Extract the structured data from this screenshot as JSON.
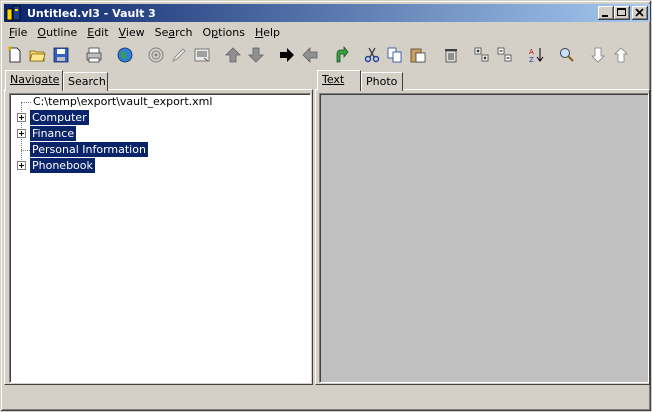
{
  "window": {
    "title": "Untitled.vl3 - Vault 3",
    "min_label": "minimize",
    "max_label": "maximize",
    "close_label": "close"
  },
  "menu": {
    "items": [
      {
        "label": "File"
      },
      {
        "label": "Outline"
      },
      {
        "label": "Edit"
      },
      {
        "label": "View"
      },
      {
        "label": "Search"
      },
      {
        "label": "Options"
      },
      {
        "label": "Help"
      }
    ]
  },
  "toolbar": {
    "buttons": [
      {
        "icon": "new-file-icon"
      },
      {
        "icon": "open-folder-icon"
      },
      {
        "icon": "save-icon"
      },
      {
        "icon": "print-icon"
      },
      {
        "icon": "globe-icon"
      },
      {
        "icon": "target-icon"
      },
      {
        "icon": "pencil-icon"
      },
      {
        "icon": "image-icon"
      },
      {
        "icon": "arrow-up-icon"
      },
      {
        "icon": "arrow-down-icon"
      },
      {
        "icon": "arrow-right-icon"
      },
      {
        "icon": "arrow-left-icon"
      },
      {
        "icon": "undo-icon"
      },
      {
        "icon": "cut-icon"
      },
      {
        "icon": "copy-icon"
      },
      {
        "icon": "paste-icon"
      },
      {
        "icon": "delete-icon"
      },
      {
        "icon": "expand-all-icon"
      },
      {
        "icon": "collapse-all-icon"
      },
      {
        "icon": "sort-icon"
      },
      {
        "icon": "find-icon"
      },
      {
        "icon": "find-next-icon"
      },
      {
        "icon": "find-prev-icon"
      }
    ]
  },
  "left_tabs": [
    {
      "label": "Navigate",
      "active": true
    },
    {
      "label": "Search",
      "active": false
    }
  ],
  "right_tabs": [
    {
      "label": "Text",
      "active": true
    },
    {
      "label": "Photo",
      "active": false
    }
  ],
  "tree": {
    "root": "C:\\temp\\export\\vault_export.xml",
    "items": [
      {
        "label": "Computer",
        "expandable": true,
        "selected": true
      },
      {
        "label": "Finance",
        "expandable": true,
        "selected": true
      },
      {
        "label": "Personal Information",
        "expandable": false,
        "selected": true
      },
      {
        "label": "Phonebook",
        "expandable": true,
        "selected": true
      }
    ]
  },
  "colors": {
    "titlebar_start": "#0a246a",
    "titlebar_end": "#a6caf0",
    "selection": "#0a246a",
    "face": "#d4d0c8",
    "text_area": "#c0c0c0"
  }
}
